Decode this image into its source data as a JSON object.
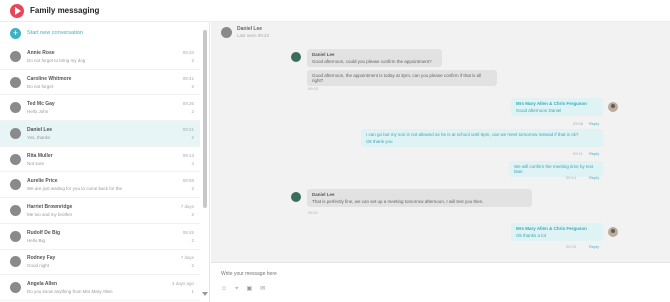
{
  "app": {
    "title": "Family messaging"
  },
  "sidebar": {
    "new_conversation": "Start new conversation",
    "conversations": [
      {
        "name": "Annie Rose",
        "preview": "Do not forget to bring my dog",
        "time": "09:33",
        "count": "2"
      },
      {
        "name": "Caroline Whitmore",
        "preview": "Do not forget",
        "time": "08:41",
        "count": "2"
      },
      {
        "name": "Ted Mc Gay",
        "preview": "Hello John",
        "time": "09:26",
        "count": "2"
      },
      {
        "name": "Daniel Lee",
        "preview": "Yes, thanks",
        "time": "09:21",
        "count": "2"
      },
      {
        "name": "Rita Muller",
        "preview": "Not sure",
        "time": "09:13",
        "count": "4"
      },
      {
        "name": "Aurelie Price",
        "preview": "We are just waiting for you to come back for the",
        "time": "08:58",
        "count": "2"
      },
      {
        "name": "Harriet Brownridge",
        "preview": "Me too and my brother",
        "time": "7 days",
        "count": "2"
      },
      {
        "name": "Rudolf De Big",
        "preview": "Hello Big",
        "time": "08:45",
        "count": "2"
      },
      {
        "name": "Rodney Fay",
        "preview": "Good night",
        "time": "7 days",
        "count": "2"
      },
      {
        "name": "Angela Allen",
        "preview": "Do you know anything from Mrs Mary Allen",
        "time": "4 days ago",
        "count": "1"
      }
    ]
  },
  "chat": {
    "header": {
      "name": "Daniel Lee",
      "sub": "Last seen 09:23"
    },
    "messages": [
      {
        "dir": "in",
        "sender": "Daniel Lee",
        "lines": [
          "Good afternoon, could you please confirm the appointment?",
          "Good afternoon, the appointment is today at 3pm, can you please confirm if that is all right?"
        ],
        "time": "09:03"
      },
      {
        "dir": "out",
        "sender": "Mrs Mary Allen & Chris Ferguson",
        "lines": [
          "Good afternoon Daniel"
        ],
        "time": "09:08",
        "reply": "Reply"
      },
      {
        "dir": "out",
        "sender": "",
        "lines": [
          "I can go but my son is not allowed as he is at school until 6pm, can we meet tomorrow instead if that is ok?",
          "Ok thank you"
        ],
        "time": "09:11",
        "reply": "Reply"
      },
      {
        "dir": "out",
        "sender": "",
        "lines": [
          "We will confirm the meeting time by text later."
        ],
        "time": "09:14",
        "reply": "Reply"
      },
      {
        "dir": "in",
        "sender": "Daniel Lee",
        "lines": [
          "That is perfectly fine, we can set up a meeting tomorrow afternoon, I will text you then."
        ],
        "time": "09:21"
      },
      {
        "dir": "out",
        "sender": "Mrs Mary Allen & Chris Ferguson",
        "lines": [
          "Ok thanks a lot"
        ],
        "time": "09:23",
        "reply": "Reply"
      }
    ]
  },
  "composer": {
    "placeholder": "Write your message here",
    "tools": [
      "☺",
      "⌖",
      "▣",
      "✉"
    ]
  },
  "colors": {
    "accent": "#3bb3c3",
    "brand": "#e8475a",
    "incoming_avatar": "#3a6d5c"
  },
  "icons": {
    "logo": "play-logo-icon",
    "new": "plus-icon"
  }
}
